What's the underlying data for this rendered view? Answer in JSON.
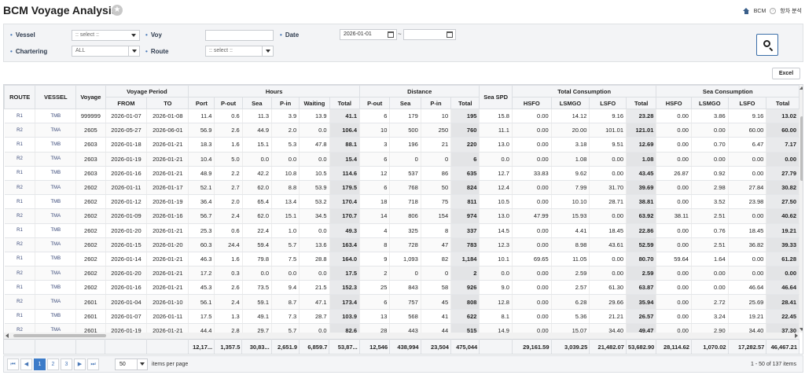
{
  "header": {
    "title": "BCM Voyage Analysis",
    "breadcrumb": [
      "BCM",
      "항차 분석"
    ]
  },
  "filters": {
    "vessel_label": "Vessel",
    "vessel_value": ":: select ::",
    "voy_label": "Voy",
    "voy_value": "",
    "date_label": "Date",
    "date_from": "2026-01-01",
    "date_sep": "~",
    "date_to": "",
    "chartering_label": "Chartering",
    "chartering_value": "ALL",
    "route_label": "Route",
    "route_value": ":: select ::"
  },
  "toolbar": {
    "excel_label": "Excel"
  },
  "grid": {
    "group_headers": {
      "voyage_period": "Voyage Period",
      "hours": "Hours",
      "distance": "Distance",
      "total_consumption": "Total Consumption",
      "sea_consumption": "Sea Consumption"
    },
    "columns": {
      "route": "ROUTE",
      "vessel": "VESSEL",
      "voyage": "Voyage",
      "from": "FROM",
      "to": "TO",
      "h_port": "Port",
      "h_pout": "P-out",
      "h_sea": "Sea",
      "h_pin": "P-in",
      "h_waiting": "Waiting",
      "h_total": "Total",
      "d_pout": "P-out",
      "d_sea": "Sea",
      "d_pin": "P-in",
      "d_total": "Total",
      "sea_spd": "Sea SPD",
      "tc_hsfo": "HSFO",
      "tc_lsmgo": "LSMGO",
      "tc_lsfo": "LSFO",
      "tc_total": "Total",
      "sc_hsfo": "HSFO",
      "sc_lsmgo": "LSMGO",
      "sc_lsfo": "LSFO",
      "sc_total": "Total"
    },
    "rows": [
      [
        "R1",
        "TMB",
        "999999",
        "2026-01-07",
        "2026-01-08",
        "11.4",
        "0.6",
        "11.3",
        "3.9",
        "13.9",
        "41.1",
        "6",
        "179",
        "10",
        "195",
        "15.8",
        "0.00",
        "14.12",
        "9.16",
        "23.28",
        "0.00",
        "3.86",
        "9.16",
        "13.02"
      ],
      [
        "R2",
        "TMA",
        "2605",
        "2026-05-27",
        "2026-06-01",
        "56.9",
        "2.6",
        "44.9",
        "2.0",
        "0.0",
        "106.4",
        "10",
        "500",
        "250",
        "760",
        "11.1",
        "0.00",
        "20.00",
        "101.01",
        "121.01",
        "0.00",
        "0.00",
        "60.00",
        "60.00"
      ],
      [
        "R1",
        "TMB",
        "2603",
        "2026-01-18",
        "2026-01-21",
        "18.3",
        "1.6",
        "15.1",
        "5.3",
        "47.8",
        "88.1",
        "3",
        "196",
        "21",
        "220",
        "13.0",
        "0.00",
        "3.18",
        "9.51",
        "12.69",
        "0.00",
        "0.70",
        "6.47",
        "7.17"
      ],
      [
        "R2",
        "TMA",
        "2603",
        "2026-01-19",
        "2026-01-21",
        "10.4",
        "5.0",
        "0.0",
        "0.0",
        "0.0",
        "15.4",
        "6",
        "0",
        "0",
        "6",
        "0.0",
        "0.00",
        "1.08",
        "0.00",
        "1.08",
        "0.00",
        "0.00",
        "0.00",
        "0.00"
      ],
      [
        "R1",
        "TMB",
        "2603",
        "2026-01-16",
        "2026-01-21",
        "48.9",
        "2.2",
        "42.2",
        "10.8",
        "10.5",
        "114.6",
        "12",
        "537",
        "86",
        "635",
        "12.7",
        "33.83",
        "9.62",
        "0.00",
        "43.45",
        "26.87",
        "0.92",
        "0.00",
        "27.79"
      ],
      [
        "R2",
        "TMA",
        "2602",
        "2026-01-11",
        "2026-01-17",
        "52.1",
        "2.7",
        "62.0",
        "8.8",
        "53.9",
        "179.5",
        "6",
        "768",
        "50",
        "824",
        "12.4",
        "0.00",
        "7.99",
        "31.70",
        "39.69",
        "0.00",
        "2.98",
        "27.84",
        "30.82"
      ],
      [
        "R1",
        "TMB",
        "2602",
        "2026-01-12",
        "2026-01-19",
        "36.4",
        "2.0",
        "65.4",
        "13.4",
        "53.2",
        "170.4",
        "18",
        "718",
        "75",
        "811",
        "10.5",
        "0.00",
        "10.10",
        "28.71",
        "38.81",
        "0.00",
        "3.52",
        "23.98",
        "27.50"
      ],
      [
        "R2",
        "TMA",
        "2602",
        "2026-01-09",
        "2026-01-16",
        "56.7",
        "2.4",
        "62.0",
        "15.1",
        "34.5",
        "170.7",
        "14",
        "806",
        "154",
        "974",
        "13.0",
        "47.99",
        "15.93",
        "0.00",
        "63.92",
        "38.11",
        "2.51",
        "0.00",
        "40.62"
      ],
      [
        "R1",
        "TMB",
        "2602",
        "2026-01-20",
        "2026-01-21",
        "25.3",
        "0.6",
        "22.4",
        "1.0",
        "0.0",
        "49.3",
        "4",
        "325",
        "8",
        "337",
        "14.5",
        "0.00",
        "4.41",
        "18.45",
        "22.86",
        "0.00",
        "0.76",
        "18.45",
        "19.21"
      ],
      [
        "R2",
        "TMA",
        "2602",
        "2026-01-15",
        "2026-01-20",
        "60.3",
        "24.4",
        "59.4",
        "5.7",
        "13.6",
        "163.4",
        "8",
        "728",
        "47",
        "783",
        "12.3",
        "0.00",
        "8.98",
        "43.61",
        "52.59",
        "0.00",
        "2.51",
        "36.82",
        "39.33"
      ],
      [
        "R1",
        "TMB",
        "2602",
        "2026-01-14",
        "2026-01-21",
        "46.3",
        "1.6",
        "79.8",
        "7.5",
        "28.8",
        "164.0",
        "9",
        "1,093",
        "82",
        "1,184",
        "10.1",
        "69.65",
        "11.05",
        "0.00",
        "80.70",
        "59.64",
        "1.64",
        "0.00",
        "61.28"
      ],
      [
        "R2",
        "TMA",
        "2602",
        "2026-01-20",
        "2026-01-21",
        "17.2",
        "0.3",
        "0.0",
        "0.0",
        "0.0",
        "17.5",
        "2",
        "0",
        "0",
        "2",
        "0.0",
        "0.00",
        "2.59",
        "0.00",
        "2.59",
        "0.00",
        "0.00",
        "0.00",
        "0.00"
      ],
      [
        "R1",
        "TMB",
        "2602",
        "2026-01-16",
        "2026-01-21",
        "45.3",
        "2.6",
        "73.5",
        "9.4",
        "21.5",
        "152.3",
        "25",
        "843",
        "58",
        "926",
        "9.0",
        "0.00",
        "2.57",
        "61.30",
        "63.87",
        "0.00",
        "0.00",
        "46.64",
        "46.64"
      ],
      [
        "R2",
        "TMA",
        "2601",
        "2026-01-04",
        "2026-01-10",
        "56.1",
        "2.4",
        "59.1",
        "8.7",
        "47.1",
        "173.4",
        "6",
        "757",
        "45",
        "808",
        "12.8",
        "0.00",
        "6.28",
        "29.66",
        "35.94",
        "0.00",
        "2.72",
        "25.69",
        "28.41"
      ],
      [
        "R1",
        "TMB",
        "2601",
        "2026-01-07",
        "2026-01-11",
        "17.5",
        "1.3",
        "49.1",
        "7.3",
        "28.7",
        "103.9",
        "13",
        "568",
        "41",
        "622",
        "8.1",
        "0.00",
        "5.36",
        "21.21",
        "26.57",
        "0.00",
        "3.24",
        "19.21",
        "22.45"
      ],
      [
        "R2",
        "TMA",
        "2601",
        "2026-01-19",
        "2026-01-21",
        "44.4",
        "2.8",
        "29.7",
        "5.7",
        "0.0",
        "82.6",
        "28",
        "443",
        "44",
        "515",
        "14.9",
        "0.00",
        "15.07",
        "34.40",
        "49.47",
        "0.00",
        "2.90",
        "34.40",
        "37.30"
      ]
    ],
    "footer": [
      "",
      "",
      "",
      "",
      "",
      "12,17...",
      "1,357.5",
      "30,83...",
      "2,651.9",
      "6,859.7",
      "53,87...",
      "12,546",
      "438,994",
      "23,504",
      "475,044",
      "",
      "29,161.59",
      "3,039.25",
      "21,482.07",
      "53,682.90",
      "28,114.62",
      "1,070.02",
      "17,282.57",
      "46,467.21"
    ]
  },
  "pager": {
    "first": "⏮",
    "prev": "◀",
    "pages": [
      "1",
      "2",
      "3"
    ],
    "next": "▶",
    "last": "⏭",
    "page_size": "50",
    "page_size_label": "items per page",
    "info": "1 - 50 of 137 items"
  },
  "colors": {
    "accent": "#3d7cc9",
    "total_col": "#e9eaec",
    "panel": "#f3f4f6"
  }
}
